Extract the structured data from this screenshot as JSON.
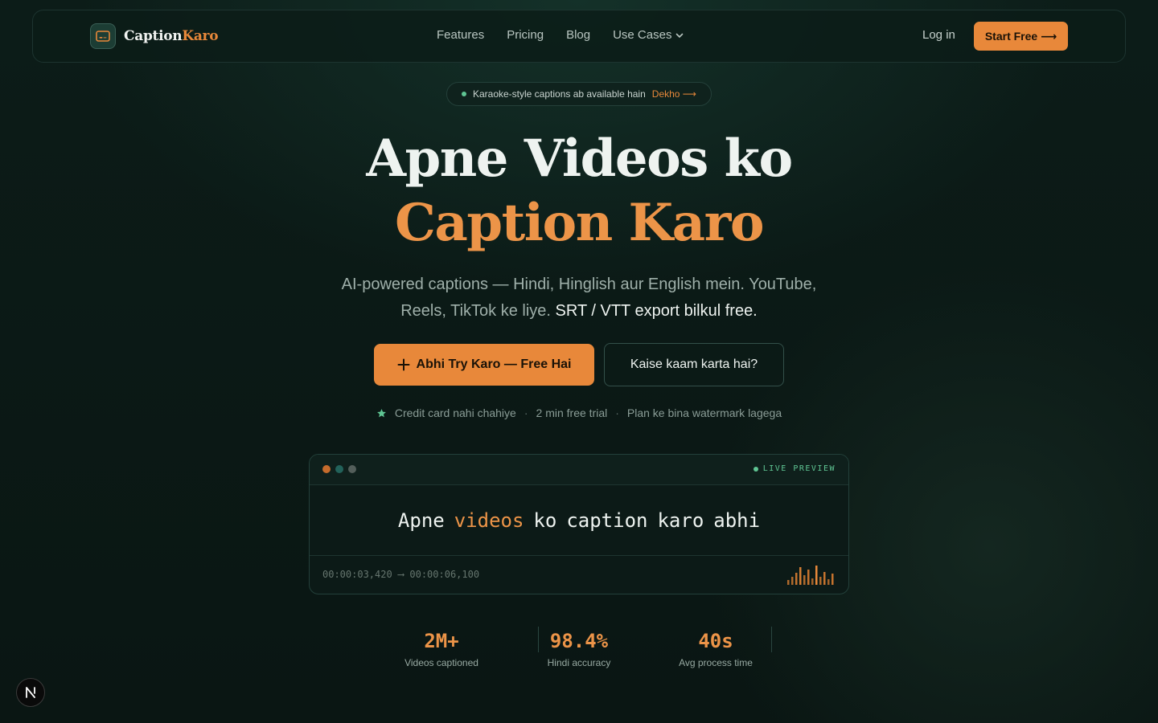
{
  "nav": {
    "brand_first": "Caption",
    "brand_second": "Karo",
    "menu": [
      "Features",
      "Pricing",
      "Blog",
      "Use Cases"
    ],
    "login": "Log in",
    "start": "Start Free ⟶"
  },
  "badge": {
    "text": "Karaoke-style captions ab available hain",
    "link": "Dekho ⟶"
  },
  "hero": {
    "line1": "Apne Videos ko",
    "line2": "Caption Karo",
    "sub_a": "AI-powered captions — Hindi, Hinglish aur English mein. YouTube,",
    "sub_b": "Reels, TikTok ke liye.",
    "sub_c": "SRT / VTT export bilkul free.",
    "cta_primary": "Abhi Try Karo — Free Hai",
    "cta_secondary": "Kaise kaam karta hai?",
    "meta": [
      "Credit card nahi chahiye",
      "2 min free trial",
      "Plan ke bina watermark lagega"
    ]
  },
  "preview": {
    "live": "LIVE PREVIEW",
    "caption": [
      "Apne",
      "videos",
      "ko",
      "caption",
      "karo",
      "abhi"
    ],
    "timecode": "00:00:03,420 ⟶ 00:00:06,100"
  },
  "stats": [
    {
      "value": "2M+",
      "label": "Videos captioned"
    },
    {
      "value": "98.4%",
      "label": "Hindi accuracy"
    },
    {
      "value": "40s",
      "label": "Avg process time"
    }
  ],
  "colors": {
    "accent": "#e8883a",
    "live": "#5fc593",
    "bg": "#0c1c18"
  },
  "icons": [
    "caption-icon",
    "chevron-down-icon",
    "plus-icon",
    "star-icon",
    "nextjs-icon"
  ]
}
